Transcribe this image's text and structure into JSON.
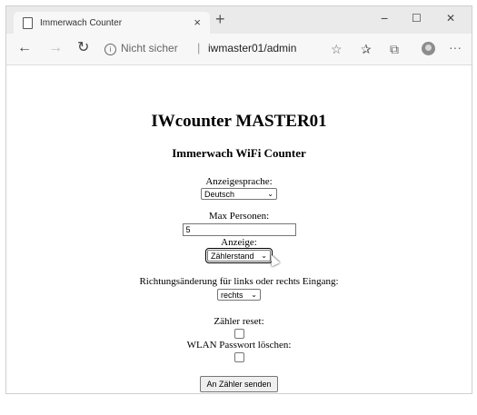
{
  "browser": {
    "tab_title": "Immerwach Counter",
    "tab_close": "×",
    "new_tab": "+",
    "minimize": "−",
    "maximize": "☐",
    "close": "✕",
    "back": "←",
    "forward": "→",
    "refresh": "↻",
    "info_icon": "i",
    "security_text": "Nicht sicher",
    "separator": "|",
    "url": "iwmaster01/admin",
    "favorite_icon": "☆",
    "favorites_icon": "✰",
    "collections_icon": "⧉",
    "more_icon": "···"
  },
  "page": {
    "title": "IWcounter MASTER01",
    "subtitle": "Immerwach WiFi Counter",
    "language_label": "Anzeigesprache:",
    "language_value": "Deutsch",
    "max_persons_label": "Max Personen:",
    "max_persons_value": "5",
    "display_label": "Anzeige:",
    "display_value": "Zählerstand",
    "direction_label": "Richtungsänderung für links oder rechts Eingang:",
    "direction_value": "rechts",
    "reset_label": "Zähler reset:",
    "reset_checked": false,
    "wlan_label": "WLAN Passwort löschen:",
    "wlan_checked": false,
    "submit_label": "An Zähler senden"
  },
  "chevron": "⌄"
}
